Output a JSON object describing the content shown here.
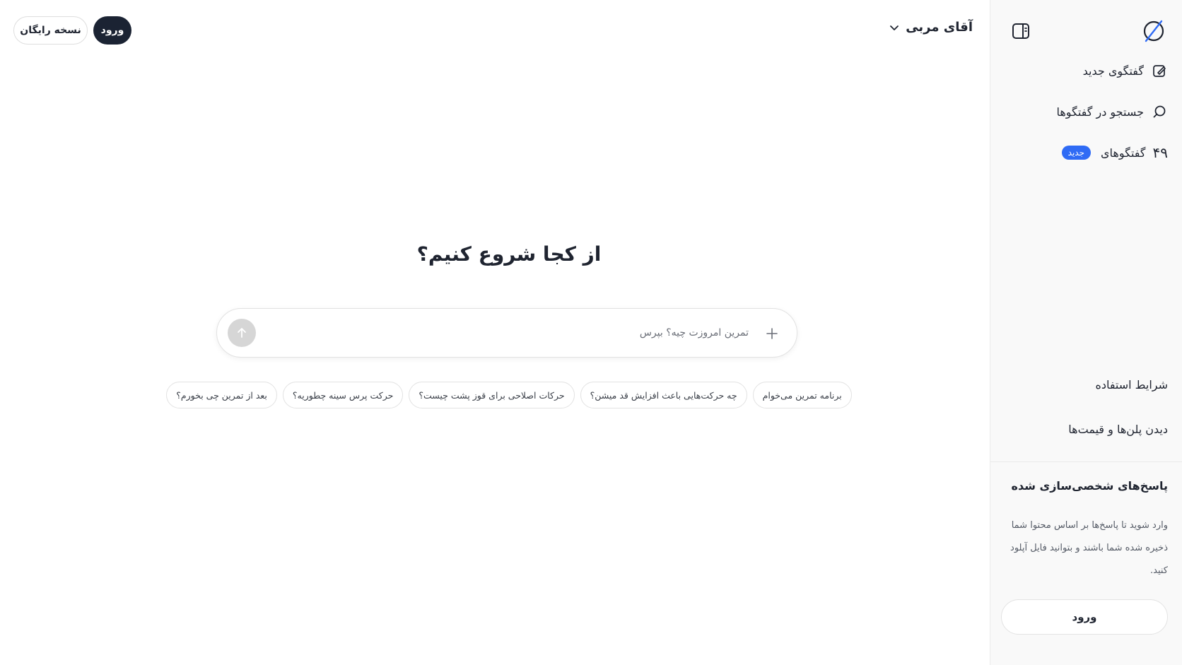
{
  "header": {
    "model_name": "آقای مربی",
    "login_label": "ورود",
    "free_version_label": "نسخه رایگان"
  },
  "main": {
    "headline": "از کجا شروع کنیم؟",
    "composer": {
      "placeholder": "تمرین امروزت چیه؟ بپرس",
      "value": ""
    },
    "suggestions": [
      "برنامه تمرین می‌خوام",
      "چه حرکت‌هایی باعث افزایش قد میشن؟",
      "حرکات اصلاحی برای قوز پشت چیست؟",
      "حرکت پرس سینه چطوریه؟",
      "بعد از تمرین چی بخورم؟"
    ]
  },
  "sidebar": {
    "new_chat_label": "گفتگوی جدید",
    "search_label": "جستجو در گفتگوها",
    "chats_label": "گفتگوهای",
    "chats_count": "۴۹",
    "chats_badge": "جدید",
    "terms_label": "شرایط استفاده",
    "plans_label": "دیدن پلن‌ها و قیمت‌ها",
    "promo_title": "پاسخ‌های شخصی‌سازی شده",
    "promo_text": "وارد شوید تا پاسخ‌ها بر اساس محتوا‌ شما ذخیره شده شما باشند و بتوانید فایل آپلود کنید.",
    "promo_login_label": "ورود"
  },
  "colors": {
    "primary_dark": "#1b2333",
    "badge_blue": "#2f6bf5",
    "logo_blue": "#2f6bf5",
    "sidebar_bg": "#f9f9f9"
  },
  "icons": {
    "logo": "slashed-circle-logo",
    "toggle": "sidebar-toggle-icon",
    "new_chat": "edit-icon",
    "search": "search-icon",
    "chevron": "chevron-down-icon",
    "send": "arrow-up-icon",
    "attach": "plus-icon"
  }
}
